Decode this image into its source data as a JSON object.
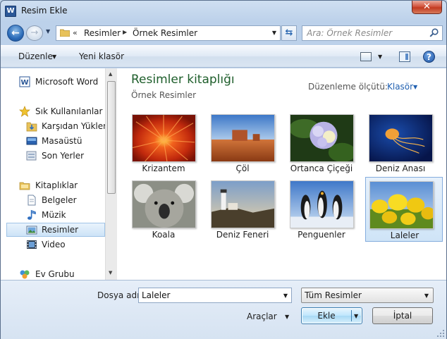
{
  "window": {
    "title": "Resim Ekle",
    "app_icon_letter": "W",
    "close_symbol": "✕"
  },
  "navbar": {
    "back_symbol": "←",
    "forward_symbol": "→",
    "address_chevron": "«",
    "breadcrumb": [
      "Resimler",
      "Örnek Resimler"
    ],
    "breadcrumb_separator": "▶",
    "refresh_symbol": "⇆",
    "search_placeholder": "Ara: Örnek Resimler"
  },
  "toolbar": {
    "organize_label": "Düzenle",
    "new_folder_label": "Yeni klasör",
    "help_symbol": "?"
  },
  "sidebar": {
    "items": [
      {
        "label": "Microsoft Word",
        "icon": "word-icon"
      },
      {
        "label": "Sık Kullanılanlar",
        "icon": "star-icon"
      },
      {
        "label": "Karşıdan Yüklemeler",
        "icon": "downloads-folder-icon"
      },
      {
        "label": "Masaüstü",
        "icon": "desktop-icon"
      },
      {
        "label": "Son Yerler",
        "icon": "recent-places-icon"
      },
      {
        "label": "Kitaplıklar",
        "icon": "libraries-icon"
      },
      {
        "label": "Belgeler",
        "icon": "documents-icon"
      },
      {
        "label": "Müzik",
        "icon": "music-icon"
      },
      {
        "label": "Resimler",
        "icon": "pictures-icon",
        "selected": true
      },
      {
        "label": "Video",
        "icon": "video-icon"
      },
      {
        "label": "Ev Grubu",
        "icon": "homegroup-icon"
      }
    ]
  },
  "library": {
    "title": "Resimler kitaplığı",
    "subtitle": "Örnek Resimler",
    "arrange_label": "Düzenleme ölçütü:",
    "arrange_value": "Klasör"
  },
  "pictures": [
    {
      "name": "Krizantem"
    },
    {
      "name": "Çöl"
    },
    {
      "name": "Ortanca Çiçeği"
    },
    {
      "name": "Deniz Anası"
    },
    {
      "name": "Koala"
    },
    {
      "name": "Deniz Feneri"
    },
    {
      "name": "Penguenler"
    },
    {
      "name": "Laleler",
      "selected": true
    }
  ],
  "bottom": {
    "filename_label": "Dosya adı:",
    "filename_value": "Laleler",
    "filter_value": "Tüm Resimler",
    "tools_label": "Araçlar",
    "insert_label": "Ekle",
    "cancel_label": "İptal"
  },
  "colors": {
    "library_title": "#1e5e2b",
    "link_blue": "#1f5fb0",
    "selection": "#cde3f7"
  }
}
